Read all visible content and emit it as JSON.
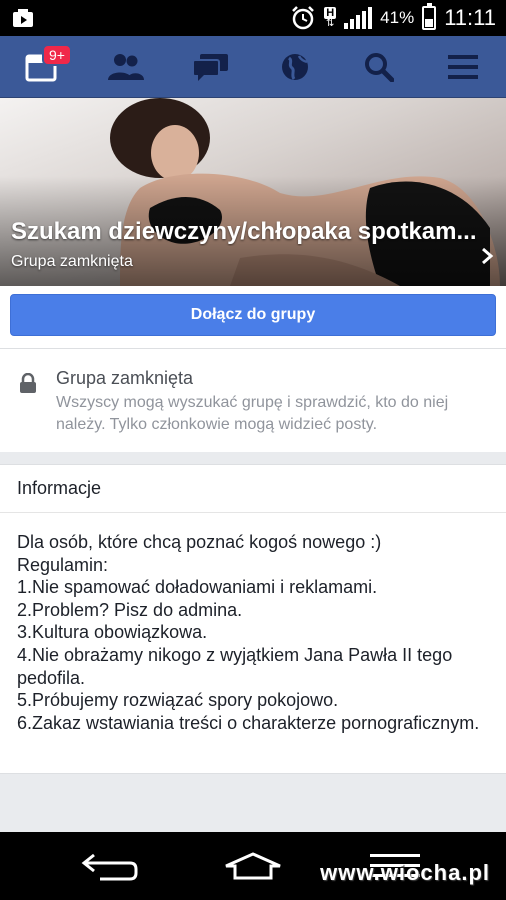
{
  "status_bar": {
    "battery_percent": "41%",
    "time": "11:11",
    "network_label": "H",
    "icons": [
      "media-icon",
      "alarm-icon",
      "network-h-icon",
      "signal-icon",
      "battery-icon"
    ]
  },
  "nav": {
    "notifications_badge": "9+",
    "items": [
      "notifications-icon",
      "friends-icon",
      "messages-icon",
      "globe-icon",
      "search-icon",
      "menu-icon"
    ]
  },
  "group": {
    "title": "Szukam dziewczyny/chłopaka spotkam...",
    "privacy_label": "Grupa zamknięta",
    "join_button": "Dołącz do grupy"
  },
  "privacy_card": {
    "title": "Grupa zamknięta",
    "description": "Wszyscy mogą wyszukać grupę i sprawdzić, kto do niej należy. Tylko członkowie mogą widzieć posty."
  },
  "info_card": {
    "header": "Informacje",
    "lines": [
      "Dla osób, które chcą poznać kogoś nowego :)",
      "Regulamin:",
      "1.Nie spamować doładowaniami i reklamami.",
      "2.Problem? Pisz do admina.",
      "3.Kultura obowiązkowa.",
      "4.Nie obrażamy nikogo z wyjątkiem Jana Pawła II tego pedofila.",
      "5.Próbujemy rozwiązać spory pokojowo.",
      "6.Zakaz wstawiania treści o charakterze pornograficznym."
    ]
  },
  "watermark": "www.wiocha.pl",
  "colors": {
    "nav_bg": "#3b5998",
    "join_button": "#4a7ee8",
    "badge": "#f02849"
  }
}
